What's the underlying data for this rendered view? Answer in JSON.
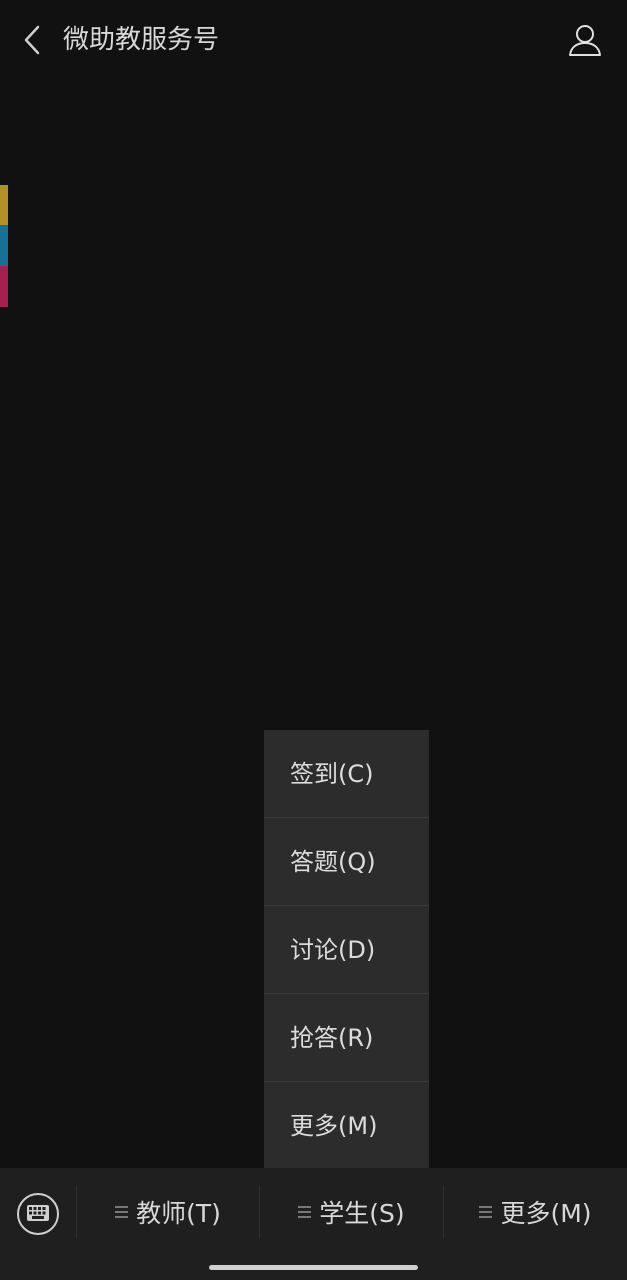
{
  "header": {
    "title": "微助教服务号",
    "back_icon": "chevron-left-icon",
    "profile_icon": "person-icon"
  },
  "edge_strip": {
    "colors": [
      "#b3902a",
      "#1a6f95",
      "#a3214f"
    ]
  },
  "popup_menu": {
    "items": [
      {
        "label": "签到(C)"
      },
      {
        "label": "答题(Q)"
      },
      {
        "label": "讨论(D)"
      },
      {
        "label": "抢答(R)"
      },
      {
        "label": "更多(M)"
      }
    ]
  },
  "bottom_bar": {
    "keyboard_icon": "keyboard-icon",
    "menus": [
      {
        "label": "教师(T)"
      },
      {
        "label": "学生(S)"
      },
      {
        "label": "更多(M)"
      }
    ]
  },
  "colors": {
    "background": "#111111",
    "popup_bg": "#2c2c2c",
    "bar_bg": "#1f1f1f",
    "text": "#d8d8d8"
  }
}
